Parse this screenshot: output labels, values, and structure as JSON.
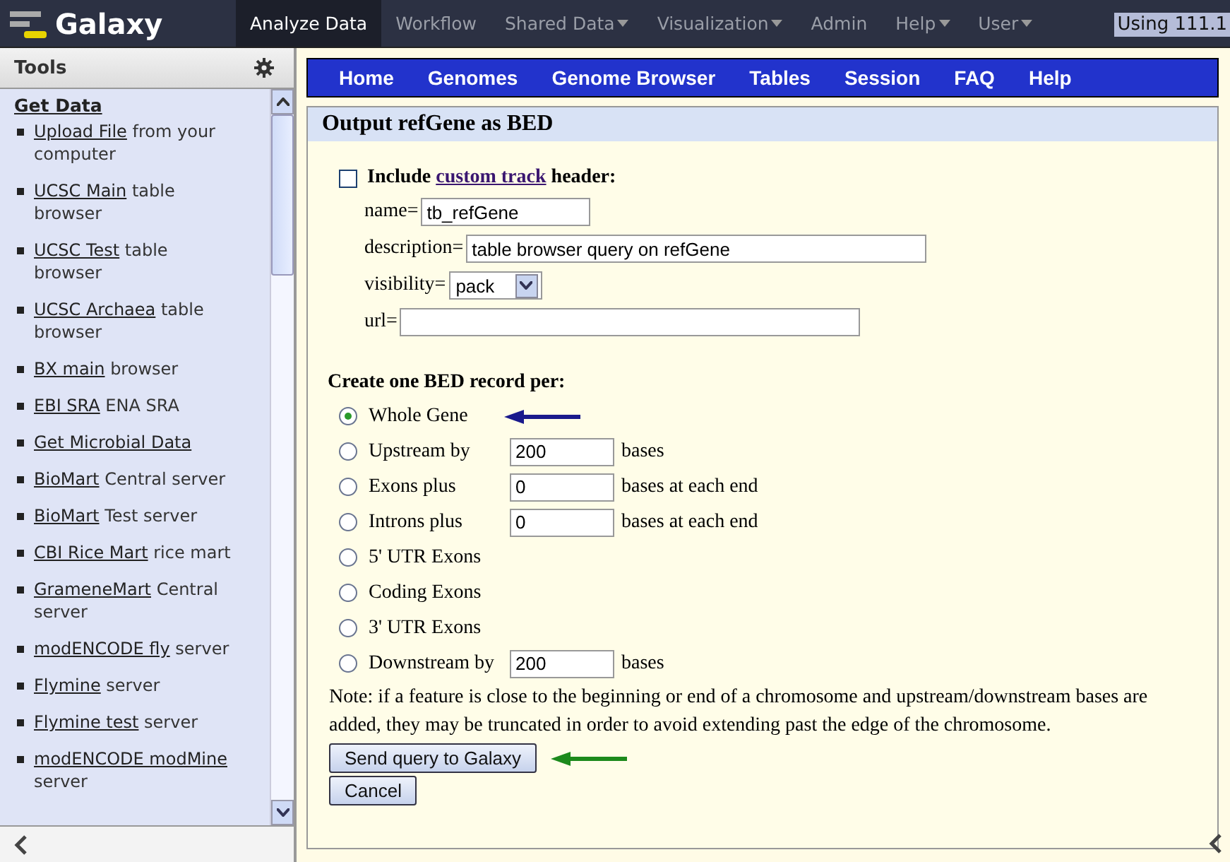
{
  "masthead": {
    "brand": "Galaxy",
    "tabs": [
      {
        "label": "Analyze Data",
        "selected": true,
        "dropdown": false
      },
      {
        "label": "Workflow",
        "selected": false,
        "dropdown": false
      },
      {
        "label": "Shared Data",
        "selected": false,
        "dropdown": true
      },
      {
        "label": "Visualization",
        "selected": false,
        "dropdown": true
      },
      {
        "label": "Admin",
        "selected": false,
        "dropdown": false
      },
      {
        "label": "Help",
        "selected": false,
        "dropdown": true
      },
      {
        "label": "User",
        "selected": false,
        "dropdown": true
      }
    ],
    "usage": "Using 111.1"
  },
  "sidebar": {
    "title": "Tools",
    "section": "Get Data",
    "items": [
      {
        "link": "Upload File",
        "rest": "from your computer"
      },
      {
        "link": "UCSC Main",
        "rest": "table browser"
      },
      {
        "link": "UCSC Test",
        "rest": "table browser"
      },
      {
        "link": "UCSC Archaea",
        "rest": "table browser"
      },
      {
        "link": "BX main",
        "rest": "browser"
      },
      {
        "link": "EBI SRA",
        "rest": "ENA SRA"
      },
      {
        "link": "Get Microbial Data"
      },
      {
        "link": "BioMart",
        "rest": "Central server"
      },
      {
        "link": "BioMart",
        "rest": "Test server"
      },
      {
        "link": "CBI Rice Mart",
        "rest": "rice mart"
      },
      {
        "link": "GrameneMart",
        "rest": "Central server"
      },
      {
        "link": "modENCODE fly",
        "rest": "server"
      },
      {
        "link": "Flymine",
        "rest": "server"
      },
      {
        "link": "Flymine test",
        "rest": "server"
      },
      {
        "link": "modENCODE modMine",
        "rest": "server"
      }
    ]
  },
  "ucsc_nav": [
    "Home",
    "Genomes",
    "Genome Browser",
    "Tables",
    "Session",
    "FAQ",
    "Help"
  ],
  "panel": {
    "title": "Output refGene as BED",
    "header_option": {
      "checked": false,
      "before": "Include",
      "link": "custom track",
      "after": "header:"
    },
    "fields": [
      {
        "kind": "text",
        "label": "name=",
        "value": "tb_refGene"
      },
      {
        "kind": "text",
        "label": "description=",
        "value": "table browser query on refGene"
      },
      {
        "kind": "select",
        "label": "visibility=",
        "value": "pack"
      },
      {
        "kind": "text",
        "label": "url="
      }
    ],
    "record_heading": "Create one BED record per:",
    "options": [
      {
        "label": "Whole Gene",
        "selected": true,
        "arrow": true
      },
      {
        "label": "Upstream by",
        "selected": false,
        "value": "200",
        "suffix": "bases",
        "arrow": false
      },
      {
        "label": "Exons plus",
        "selected": false,
        "value": "0",
        "suffix": "bases at each end",
        "arrow": false
      },
      {
        "label": "Introns plus",
        "selected": false,
        "value": "0",
        "suffix": "bases at each end",
        "arrow": false
      },
      {
        "label": "5' UTR Exons",
        "selected": false,
        "arrow": false
      },
      {
        "label": "Coding Exons",
        "selected": false,
        "arrow": false
      },
      {
        "label": "3' UTR Exons",
        "selected": false,
        "arrow": false
      },
      {
        "label": "Downstream by",
        "selected": false,
        "value": "200",
        "suffix": "bases",
        "arrow": false
      }
    ],
    "note": "Note: if a feature is close to the beginning or end of a chromosome and upstream/downstream bases are added, they may be truncated in order to avoid extending past the edge of the chromosome.",
    "buttons": [
      {
        "label": "Send query to Galaxy",
        "arrow": true
      },
      {
        "label": "Cancel",
        "arrow": false
      }
    ]
  }
}
